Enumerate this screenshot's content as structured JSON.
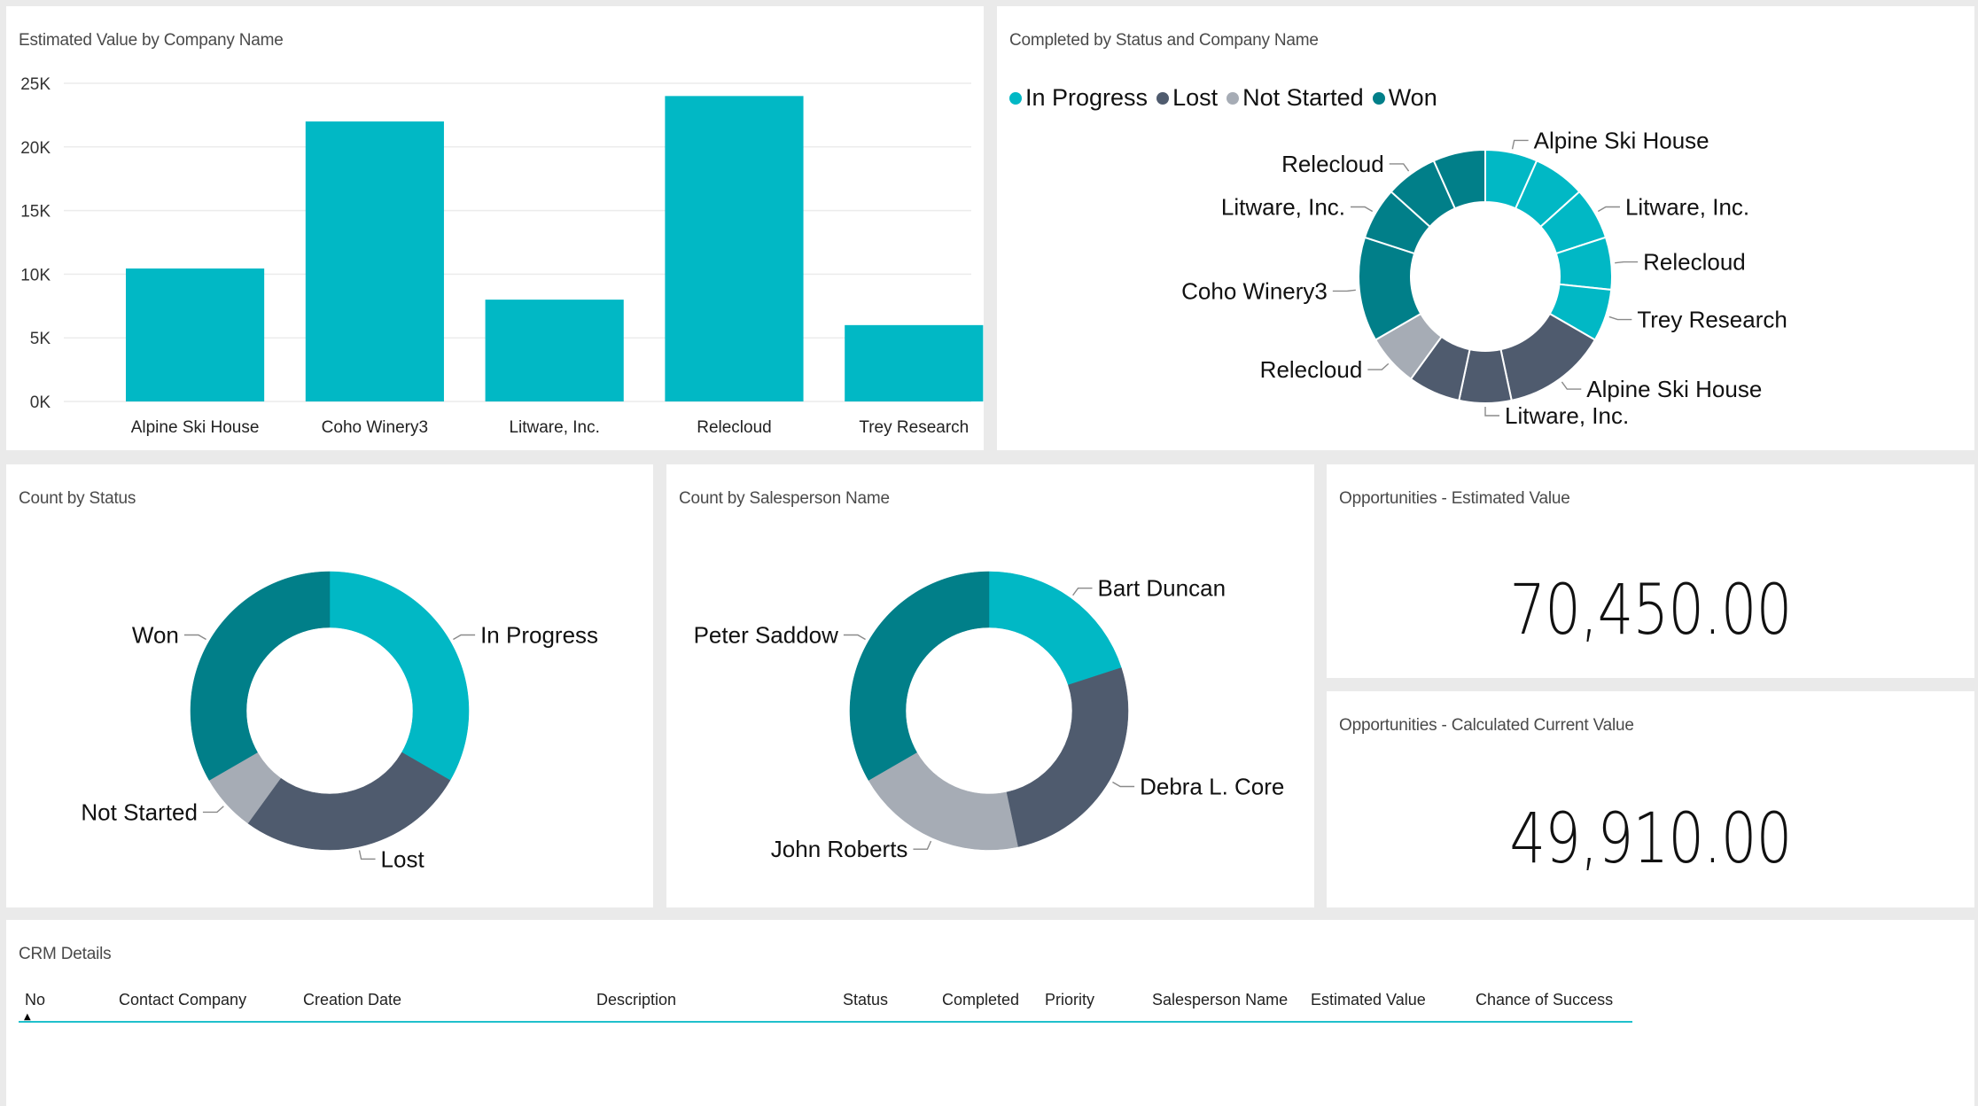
{
  "colors": {
    "in_progress": "#01B8C5",
    "lost": "#4F5B6E",
    "not_started": "#A6ACB5",
    "won": "#017F89",
    "bar": "#01B8C5",
    "table_accent": "#1FC0CC"
  },
  "chart_data": [
    {
      "id": "estimated-value-by-company",
      "type": "bar",
      "title": "Estimated Value by Company Name",
      "categories": [
        "Alpine Ski House",
        "Coho Winery3",
        "Litware, Inc.",
        "Relecloud",
        "Trey Research"
      ],
      "values": [
        10450,
        22000,
        8000,
        24000,
        6000
      ],
      "xlabel": "",
      "ylabel": "",
      "ylim": [
        0,
        25000
      ],
      "yticks": [
        0,
        5000,
        10000,
        15000,
        20000,
        25000
      ],
      "ytick_labels": [
        "0K",
        "5K",
        "10K",
        "15K",
        "20K",
        "25K"
      ],
      "grid": true
    },
    {
      "id": "completed-by-status-and-company",
      "type": "pie",
      "donut": true,
      "title": "Completed by Status and Company Name",
      "legend": {
        "placement": "top-left",
        "entries": [
          {
            "label": "In Progress",
            "color_key": "in_progress"
          },
          {
            "label": "Lost",
            "color_key": "lost"
          },
          {
            "label": "Not Started",
            "color_key": "not_started"
          },
          {
            "label": "Won",
            "color_key": "won"
          }
        ]
      },
      "segments": [
        {
          "status": "In Progress",
          "label": "Alpine Ski House",
          "value": 1
        },
        {
          "status": "In Progress",
          "label": "",
          "value": 1
        },
        {
          "status": "In Progress",
          "label": "Litware, Inc.",
          "value": 1
        },
        {
          "status": "In Progress",
          "label": "Relecloud",
          "value": 1
        },
        {
          "status": "In Progress",
          "label": "Trey Research",
          "value": 1
        },
        {
          "status": "Lost",
          "label": "Alpine Ski House",
          "value": 2
        },
        {
          "status": "Lost",
          "label": "Litware, Inc.",
          "value": 1
        },
        {
          "status": "Lost",
          "label": "",
          "value": 1
        },
        {
          "status": "Not Started",
          "label": "Relecloud",
          "value": 1
        },
        {
          "status": "Won",
          "label": "Coho Winery3",
          "value": 2
        },
        {
          "status": "Won",
          "label": "Litware, Inc.",
          "value": 1
        },
        {
          "status": "Won",
          "label": "Relecloud",
          "value": 1
        },
        {
          "status": "Won",
          "label": "",
          "value": 1
        }
      ]
    },
    {
      "id": "count-by-status",
      "type": "pie",
      "donut": true,
      "title": "Count by Status",
      "segments": [
        {
          "label": "In Progress",
          "value": 5,
          "color_key": "in_progress"
        },
        {
          "label": "Lost",
          "value": 4,
          "color_key": "lost"
        },
        {
          "label": "Not Started",
          "value": 1,
          "color_key": "not_started"
        },
        {
          "label": "Won",
          "value": 5,
          "color_key": "won"
        }
      ]
    },
    {
      "id": "count-by-salesperson",
      "type": "pie",
      "donut": true,
      "title": "Count by Salesperson Name",
      "segments": [
        {
          "label": "Bart Duncan",
          "value": 3,
          "color_key": "in_progress"
        },
        {
          "label": "Debra L. Core",
          "value": 4,
          "color_key": "lost"
        },
        {
          "label": "John Roberts",
          "value": 3,
          "color_key": "not_started"
        },
        {
          "label": "Peter Saddow",
          "value": 5,
          "color_key": "won"
        }
      ]
    }
  ],
  "kpis": {
    "estimated": {
      "title": "Opportunities - Estimated Value",
      "value": "70,450.00"
    },
    "calculated": {
      "title": "Opportunities - Calculated Current Value",
      "value": "49,910.00"
    }
  },
  "crm": {
    "title": "CRM Details",
    "sort_indicator": "▲",
    "columns": [
      "No",
      "Contact Company",
      "Creation Date",
      "Description",
      "Status",
      "Completed",
      "Priority",
      "Salesperson Name",
      "Estimated Value",
      "Chance of Success"
    ],
    "rows": []
  }
}
